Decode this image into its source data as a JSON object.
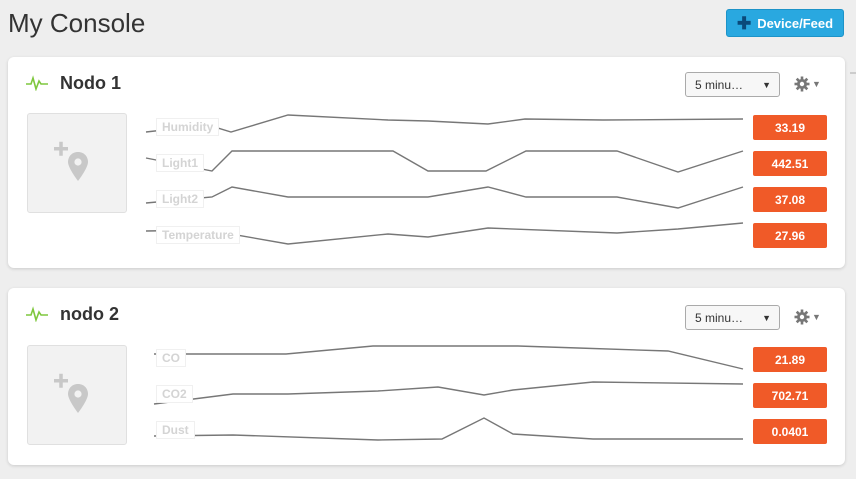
{
  "page": {
    "title": "My Console",
    "add_button_label": "Device/Feed"
  },
  "colors": {
    "accent": "#29a8e0",
    "value_badge": "#f05a28",
    "activity_icon": "#7fc73e",
    "sparkline": "#777777"
  },
  "devices": [
    {
      "name": "Nodo 1",
      "time_range": "5 minu…",
      "streams": [
        {
          "label": "Humidity",
          "value": "33.19"
        },
        {
          "label": "Light1",
          "value": "442.51"
        },
        {
          "label": "Light2",
          "value": "37.08"
        },
        {
          "label": "Temperature",
          "value": "27.96"
        }
      ]
    },
    {
      "name": "nodo 2",
      "time_range": "5 minu…",
      "streams": [
        {
          "label": "CO",
          "value": "21.89"
        },
        {
          "label": "CO2",
          "value": "702.71"
        },
        {
          "label": "Dust",
          "value": "0.0401"
        }
      ]
    }
  ]
}
